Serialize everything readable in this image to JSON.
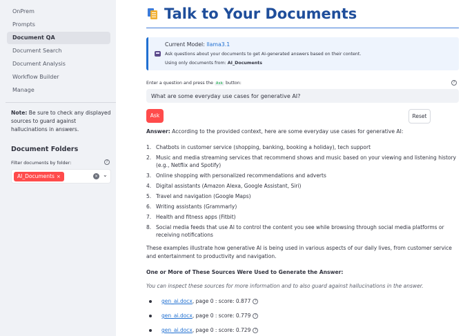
{
  "sidebar": {
    "nav": [
      "OnPrem",
      "Prompts",
      "Document QA",
      "Document Search",
      "Document Analysis",
      "Workflow Builder",
      "Manage"
    ],
    "active_index": 2,
    "note_bold": "Note:",
    "note_text": " Be sure to check any displayed sources to guard against hallucinations in answers.",
    "folders_title": "Document Folders",
    "filter_label": "Filter documents by folder:",
    "selected_folder": "AI_Documents"
  },
  "main": {
    "title": "Talk to Your Documents",
    "model_label": "Current Model: ",
    "model_name": "llama3.1",
    "info_desc": "Ask questions about your documents to get AI-generated answers based on their content.",
    "scope_prefix": "Using only documents from: ",
    "scope_folder": "AI_Documents",
    "question_label_prefix": "Enter a question and press the ",
    "question_label_chip": "Ask",
    "question_label_suffix": " button:",
    "question_value": "What are some everyday use cases for generative AI?",
    "ask_label": "Ask",
    "reset_label": "Reset",
    "answer_bold": "Answer:",
    "answer_intro": " According to the provided context, here are some everyday use cases for generative AI:",
    "answer_items": [
      {
        "num": "1.",
        "text": "Chatbots in customer service (shopping, banking, booking a holiday), tech support"
      },
      {
        "num": "2.",
        "text": "Music and media streaming services that recommend shows and music based on your viewing and listening history (e.g., Netflix and Spotify)"
      },
      {
        "num": "3.",
        "text": "Online shopping with personalized recommendations and adverts"
      },
      {
        "num": "4.",
        "text": "Digital assistants (Amazon Alexa, Google Assistant, Siri)"
      },
      {
        "num": "5.",
        "text": "Travel and navigation (Google Maps)"
      },
      {
        "num": "6.",
        "text": "Writing assistants (Grammarly)"
      },
      {
        "num": "7.",
        "text": "Health and fitness apps (Fitbit)"
      },
      {
        "num": "8.",
        "text": "Social media feeds that use AI to control the content you see while browsing through social media platforms or receiving notifications"
      }
    ],
    "summary": "These examples illustrate how generative AI is being used in various aspects of our daily lives, from customer service and entertainment to productivity and navigation.",
    "sources_heading": "One or More of These Sources Were Used to Generate the Answer:",
    "sources_sub": "You can inspect these sources for more information and to also guard against hallucinations in the answer.",
    "sources": [
      {
        "file": "gen_ai.docx",
        "meta": ", page 0 : score: 0.877"
      },
      {
        "file": "gen_ai.docx",
        "meta": ", page 0 : score: 0.779"
      },
      {
        "file": "gen_ai.docx",
        "meta": ", page 0 : score: 0.729"
      }
    ]
  },
  "colors": {
    "accent": "#ff4b4b",
    "title_blue": "#1f4e9b",
    "link_blue": "#1f6fd1",
    "sidebar_bg": "#f0f2f6"
  },
  "icons": {
    "help": "?",
    "close": "×",
    "chevron": "⌄"
  }
}
